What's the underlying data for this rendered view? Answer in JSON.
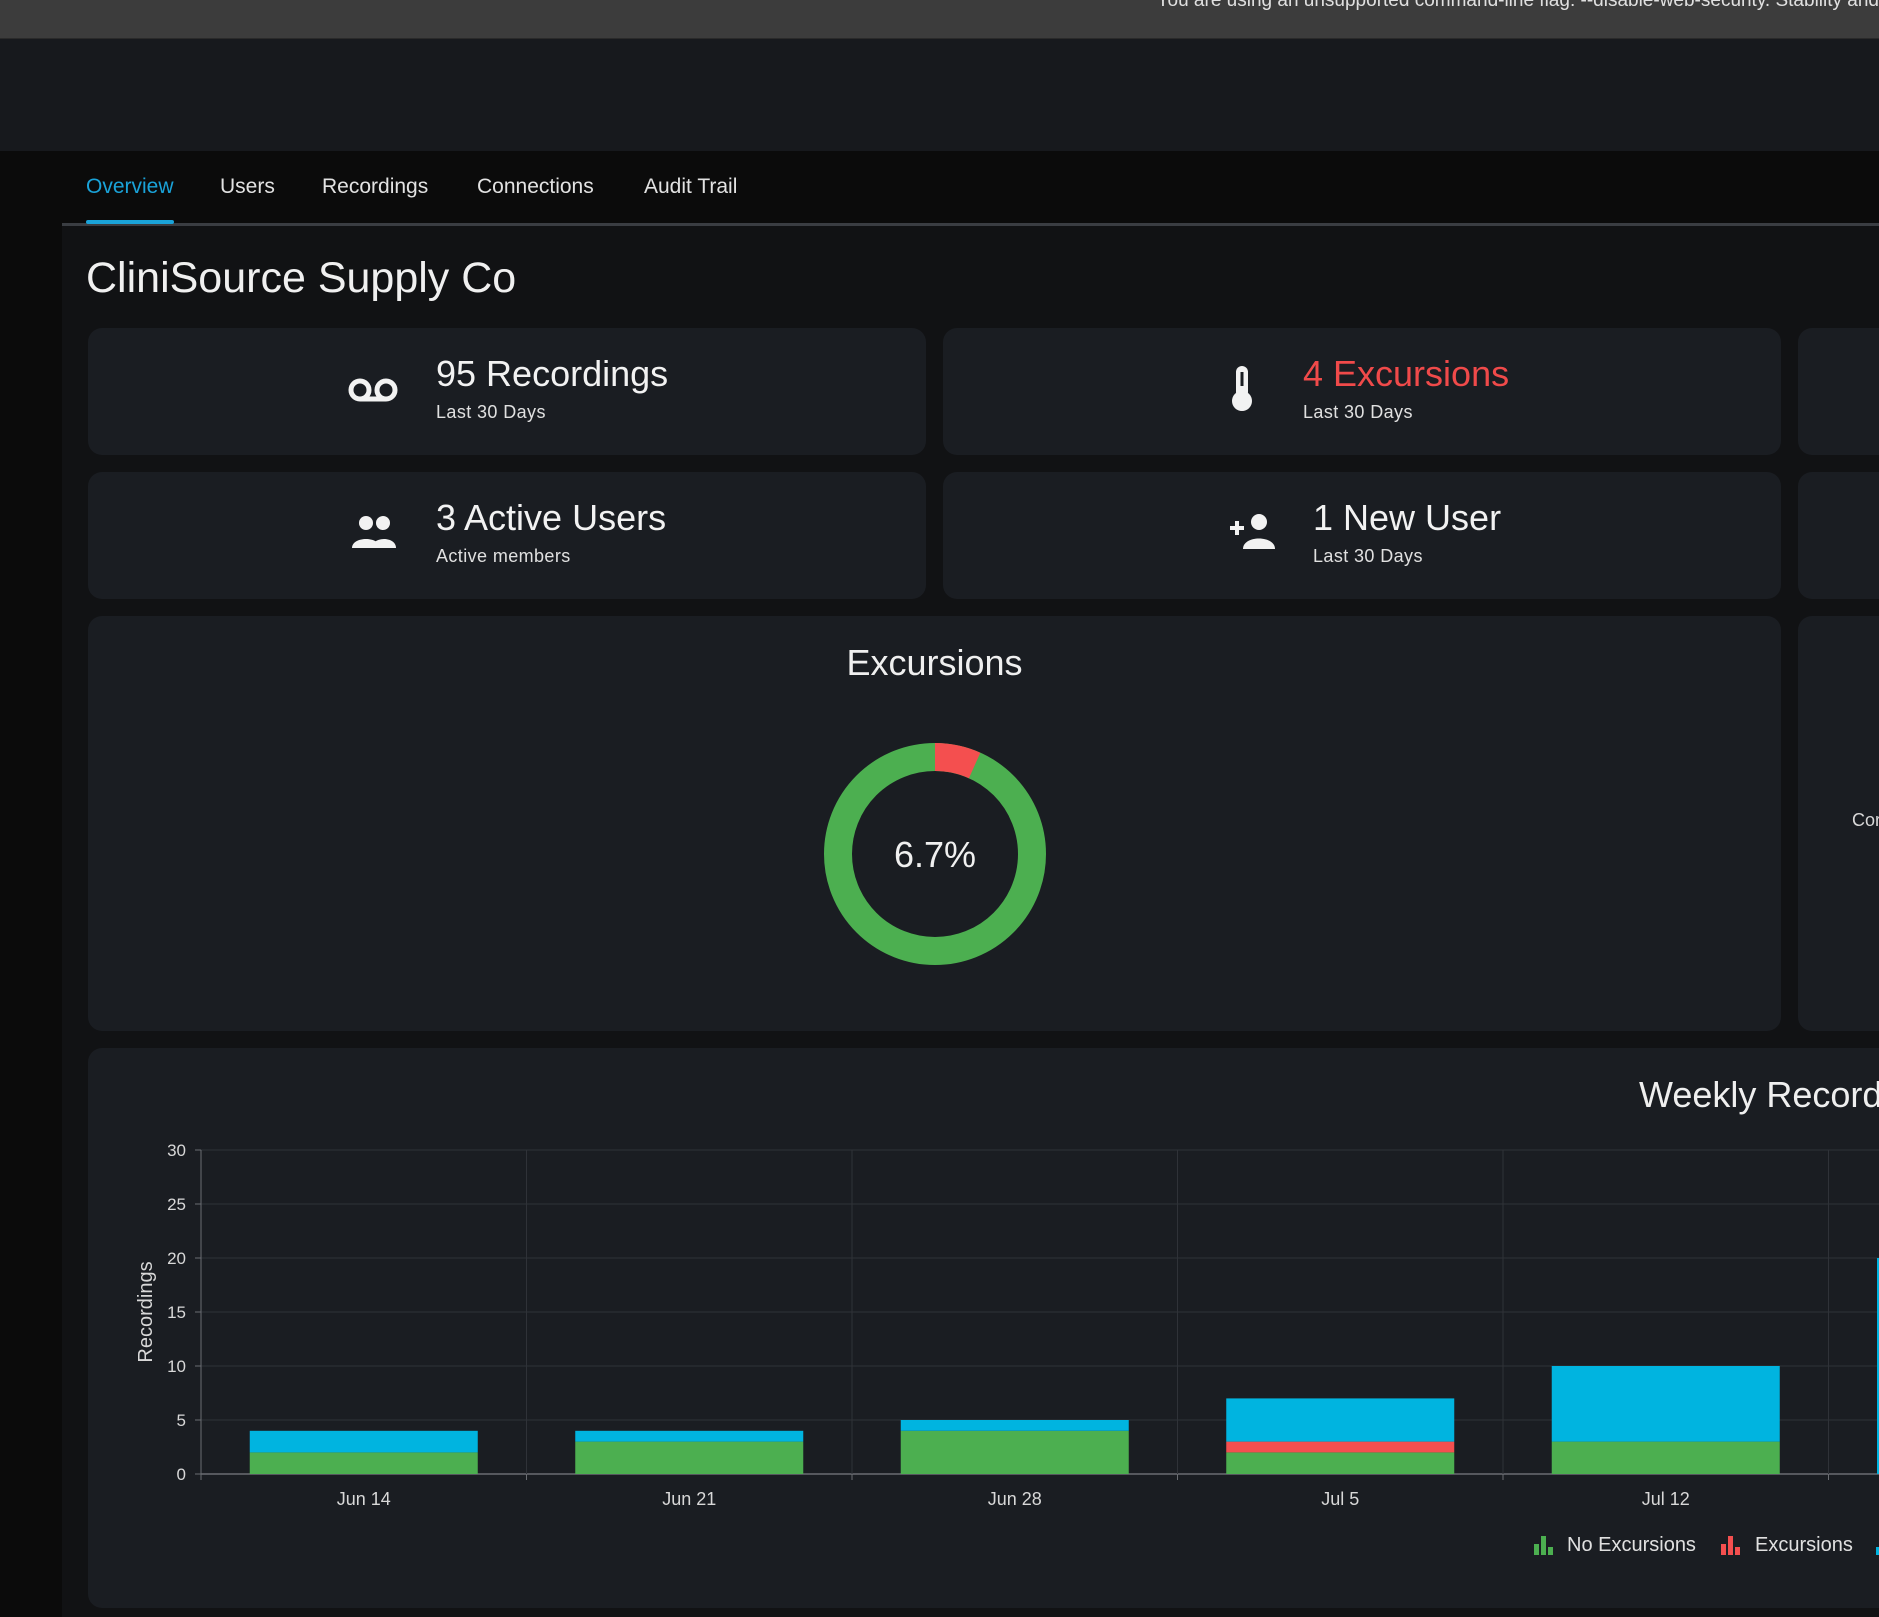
{
  "browser_infobar": {
    "text": "You are using an unsupported command-line flag: --disable-web-security. Stability and"
  },
  "tabs": [
    {
      "label": "Overview",
      "active": true
    },
    {
      "label": "Users",
      "active": false
    },
    {
      "label": "Recordings",
      "active": false
    },
    {
      "label": "Connections",
      "active": false
    },
    {
      "label": "Audit Trail",
      "active": false
    }
  ],
  "page": {
    "title": "CliniSource Supply Co"
  },
  "stats": {
    "recordings": {
      "main": "95 Recordings",
      "sub": "Last 30 Days",
      "icon": "voicemail-icon"
    },
    "excursions": {
      "main": "4 Excursions",
      "sub": "Last 30 Days",
      "icon": "thermometer-icon"
    },
    "active_users": {
      "main": "3 Active Users",
      "sub": "Active members",
      "icon": "group-icon"
    },
    "new_user": {
      "main": "1 New User",
      "sub": "Last 30 Days",
      "icon": "person-add-icon"
    }
  },
  "excursions_card": {
    "title": "Excursions",
    "center_label": "6.7%",
    "percent": 6.7
  },
  "partial_card": {
    "text": "Cor"
  },
  "colors": {
    "accent": "#1aa3d9",
    "no_excursions": "#4caf50",
    "excursions": "#f44f4f",
    "other_series": "#00b4e0"
  },
  "chart_data": {
    "type": "bar",
    "title": "Weekly Recordi",
    "ylabel": "Recordings",
    "xlabel": "",
    "ylim": [
      0,
      30
    ],
    "yticks": [
      "0",
      "5",
      "10",
      "15",
      "20",
      "25",
      "30"
    ],
    "categories": [
      "Jun 14",
      "Jun 21",
      "Jun 28",
      "Jul 5",
      "Jul 12"
    ],
    "stacked": true,
    "series": [
      {
        "name": "No Excursions",
        "color": "#4caf50",
        "values": [
          2,
          3,
          4,
          2,
          3
        ]
      },
      {
        "name": "Excursions",
        "color": "#f44f4f",
        "values": [
          0,
          0,
          0,
          1,
          0
        ]
      },
      {
        "name": "",
        "color": "#00b4e0",
        "values": [
          2,
          1,
          1,
          4,
          7
        ]
      }
    ],
    "legend_placement": "bottom-right",
    "grid": true
  }
}
